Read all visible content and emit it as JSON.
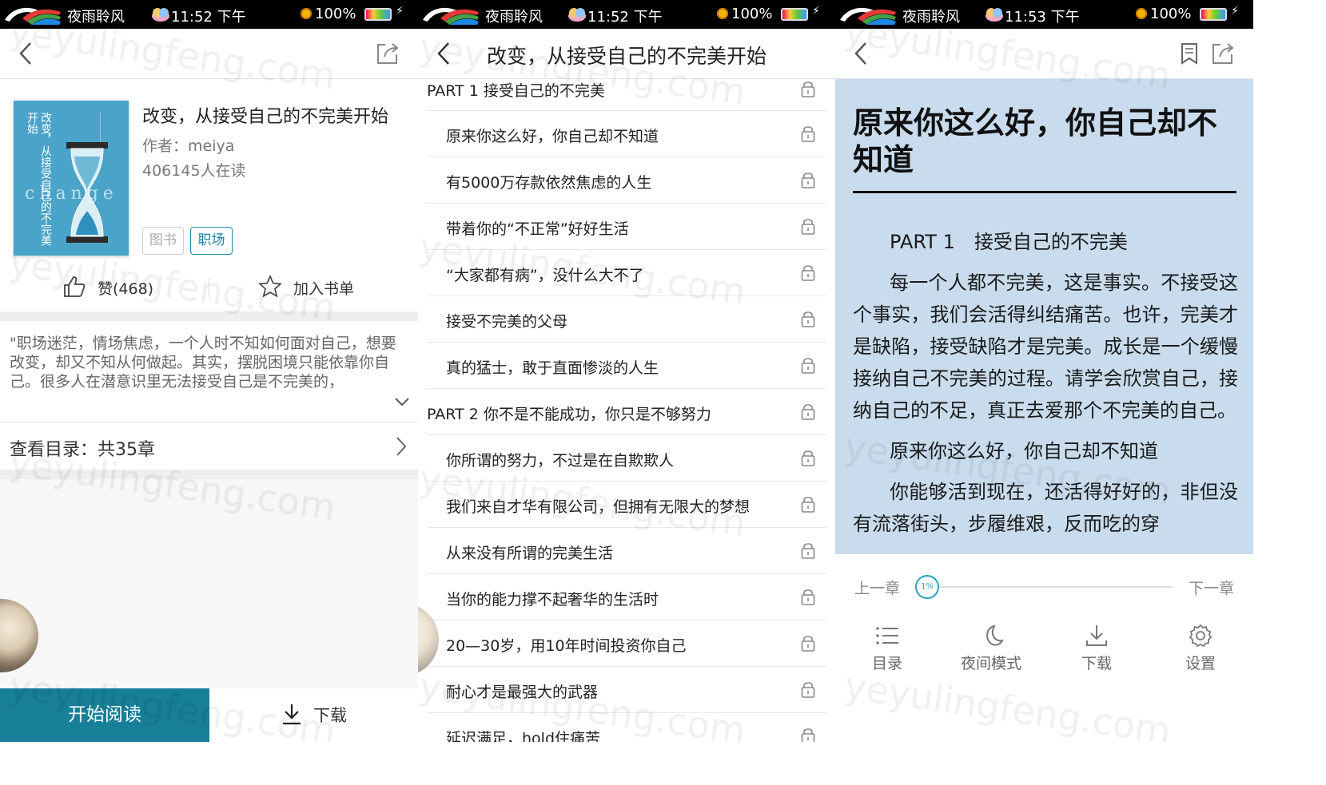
{
  "status_bars": [
    {
      "app": "夜雨聆风",
      "time": "11:52 下午",
      "battery": "100%"
    },
    {
      "app": "夜雨聆风",
      "time": "11:52 下午",
      "battery": "100%"
    },
    {
      "app": "夜雨聆风",
      "time": "11:53 下午",
      "battery": "100%"
    }
  ],
  "detail": {
    "title": "改变，从接受自己的不完美开始",
    "author": "作者：meiya",
    "readers": "406145人在读",
    "cover": {
      "title": "改变，从接受自己的不完美开始",
      "word": "change"
    },
    "tags": [
      "图书",
      "职场"
    ],
    "like": "赞(468)",
    "add_shelf": "加入书单",
    "description": "\"职场迷茫，情场焦虑，一个人时不知如何面对自己，想要改变，却又不知从何做起。其实，摆脱困境只能依靠你自己。很多人在潜意识里无法接受自己是不完美的，",
    "toc": "查看目录：共35章",
    "read_button": "开始阅读",
    "download_button": "下载"
  },
  "catalog": {
    "title": "改变，从接受自己的不完美开始",
    "chapters": [
      {
        "text": "PART 1 接受自己的不完美",
        "part": true
      },
      {
        "text": "原来你这么好，你自己却不知道",
        "part": false
      },
      {
        "text": "有5000万存款依然焦虑的人生",
        "part": false
      },
      {
        "text": "带着你的“不正常”好好生活",
        "part": false
      },
      {
        "text": "“大家都有病”，没什么大不了",
        "part": false
      },
      {
        "text": "接受不完美的父母",
        "part": false
      },
      {
        "text": "真的猛士，敢于直面惨淡的人生",
        "part": false
      },
      {
        "text": "PART 2 你不是不能成功，你只是不够努力",
        "part": true
      },
      {
        "text": "你所谓的努力，不过是在自欺欺人",
        "part": false
      },
      {
        "text": "我们来自才华有限公司，但拥有无限大的梦想",
        "part": false
      },
      {
        "text": "从来没有所谓的完美生活",
        "part": false
      },
      {
        "text": "当你的能力撑不起奢华的生活时",
        "part": false
      },
      {
        "text": "20—30岁，用10年时间投资你自己",
        "part": false
      },
      {
        "text": "耐心才是最强大的武器",
        "part": false
      },
      {
        "text": "延迟满足，hold住痛苦",
        "part": false
      }
    ]
  },
  "reader": {
    "chapter_title": "原来你这么好，你自己却不知道",
    "paragraphs": [
      "PART 1　接受自己的不完美",
      "每一个人都不完美，这是事实。不接受这个事实，我们会活得纠结痛苦。也许，完美才是缺陷，接受缺陷才是完美。成长是一个缓慢接纳自己不完美的过程。请学会欣赏自己，接纳自己的不足，真正去爱那个不完美的自己。",
      "原来你这么好，你自己却不知道",
      "你能够活到现在，还活得好好的，非但没有流落街头，步履维艰，反而吃的穿"
    ],
    "prev": "上一章",
    "next": "下一章",
    "progress_label": "1%",
    "progress": 0.01,
    "tools": [
      {
        "label": "目录",
        "icon": "list-icon"
      },
      {
        "label": "夜间模式",
        "icon": "moon-icon"
      },
      {
        "label": "下载",
        "icon": "download-icon"
      },
      {
        "label": "设置",
        "icon": "settings-icon"
      }
    ]
  },
  "colors": {
    "accent": "#177f98",
    "reader_bg": "#c9dced",
    "tag": "#1e7fa8"
  }
}
